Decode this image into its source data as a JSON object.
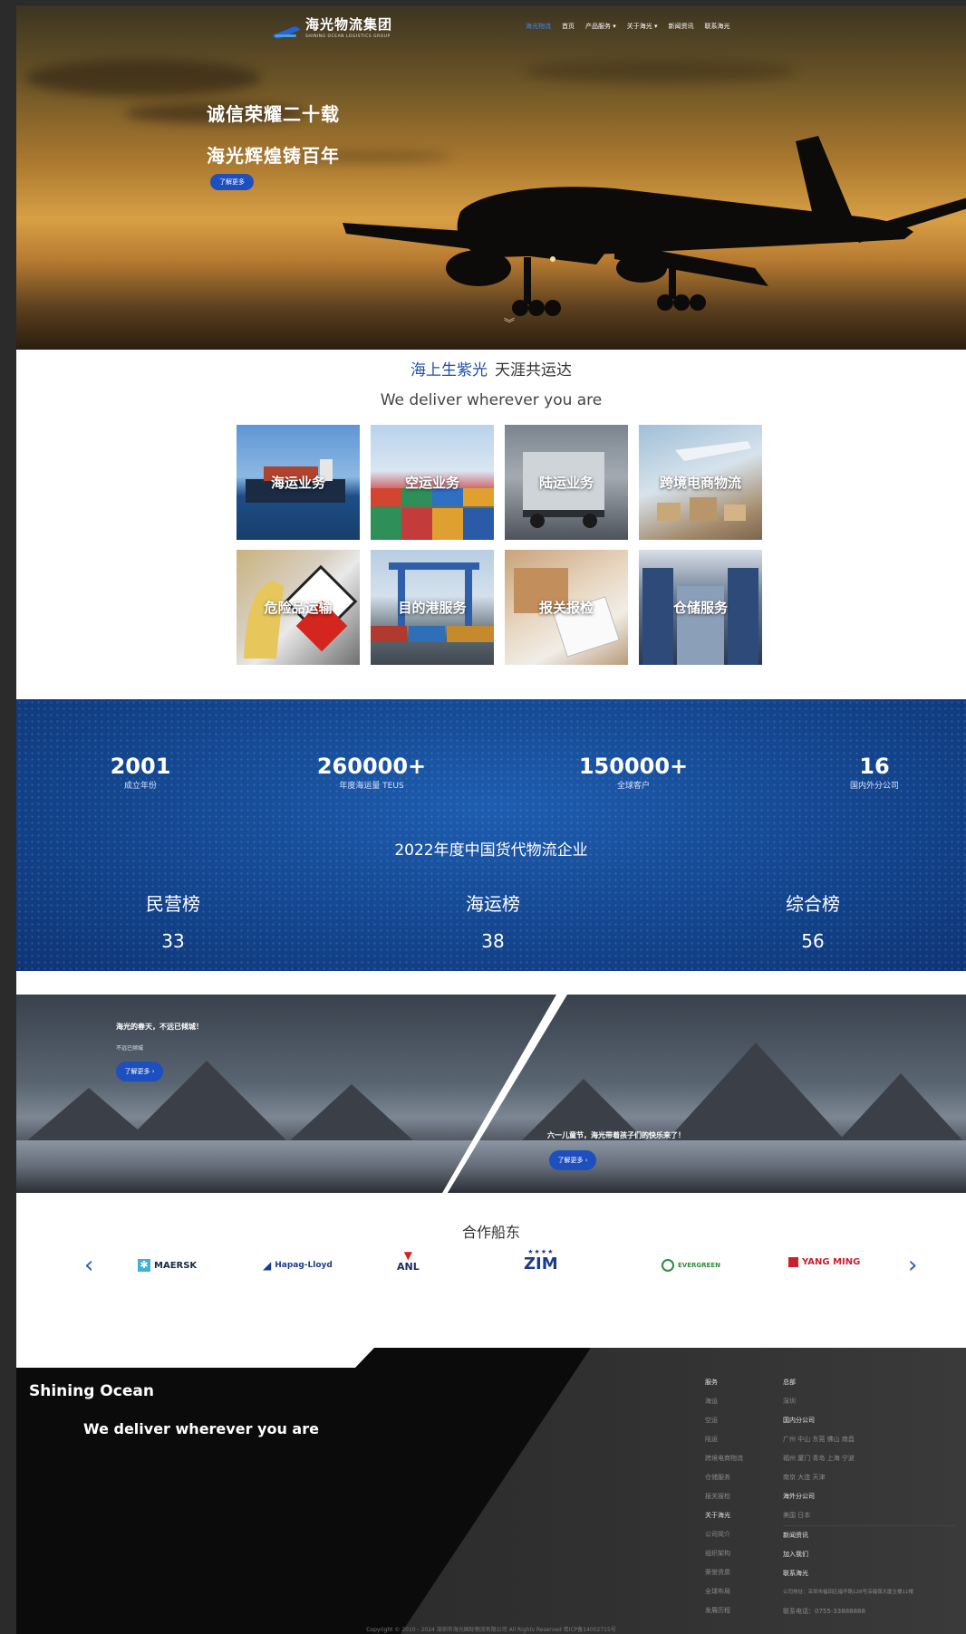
{
  "header": {
    "logo_cn": "海光物流集团",
    "logo_en": "SHINING OCEAN LOGISTICS GROUP",
    "nav": [
      "海光物流",
      "首页",
      "产品服务 ▾",
      "关于海光 ▾",
      "新闻资讯",
      "联系海光"
    ]
  },
  "hero": {
    "line1": "诚信荣耀二十载",
    "line2": "海光辉煌铸百年",
    "button": "了解更多"
  },
  "intro": {
    "slogan_a": "海上生紫光",
    "slogan_b": "天涯共运达",
    "tagline": "We deliver wherever you are"
  },
  "services": [
    {
      "label": "海运业务"
    },
    {
      "label": "空运业务"
    },
    {
      "label": "陆运业务"
    },
    {
      "label": "跨境电商物流"
    },
    {
      "label": "危险品运输"
    },
    {
      "label": "目的港服务"
    },
    {
      "label": "报关报检"
    },
    {
      "label": "仓储服务"
    }
  ],
  "stats": [
    {
      "value": "2001",
      "label": "成立年份"
    },
    {
      "value": "260000+",
      "label": "年度海运量 TEUS"
    },
    {
      "value": "150000+",
      "label": "全球客户"
    },
    {
      "value": "16",
      "label": "国内外分公司"
    }
  ],
  "ranking": {
    "title": "2022年度中国货代物流企业",
    "items": [
      {
        "name": "民营榜",
        "value": "33"
      },
      {
        "name": "海运榜",
        "value": "38"
      },
      {
        "name": "综合榜",
        "value": "56"
      }
    ]
  },
  "news": {
    "left_title": "海光的春天，不远已倾城！",
    "left_sub": "不远已倾城",
    "left_button": "了解更多 ›",
    "right_title": "六一儿童节，海光带着孩子们的快乐来了！",
    "right_button": "了解更多 ›"
  },
  "partners": {
    "title": "合作船东",
    "prev": "‹",
    "next": "›",
    "logos": [
      "MAERSK",
      "Hapag-Lloyd",
      "ANL",
      "ZIM",
      "EVERGREEN",
      "YANG MING"
    ]
  },
  "footer": {
    "brand": "Shining Ocean",
    "slogan": "We deliver wherever you are",
    "col1": [
      "服务",
      "海运",
      "空运",
      "陆运",
      "跨境电商物流",
      "仓储服务",
      "报关报检",
      "关于海光",
      "公司简介",
      "组织架构",
      "荣誉资质",
      "全球布局",
      "发展历程"
    ],
    "col2": [
      "总部",
      "深圳",
      "国内分公司",
      "广州 中山 东莞 佛山 南昌",
      "福州 厦门 青岛 上海 宁波",
      "南京 大连 天津",
      "海外分公司",
      "美国 日本",
      "新闻资讯",
      "加入我们",
      "联系海光",
      "公司地址：深圳市福田区福华路128号深福保大厦主楼11楼",
      "联系电话：0755-33888888"
    ],
    "copyright": "Copyright © 2010 - 2024 深圳市海光国际物流有限公司 All Rights Reserved 粤ICP备14002715号"
  },
  "colors": {
    "brand_blue": "#1e4fbf",
    "stats_blue": "#154a94",
    "nav_active": "#3a88ff"
  }
}
